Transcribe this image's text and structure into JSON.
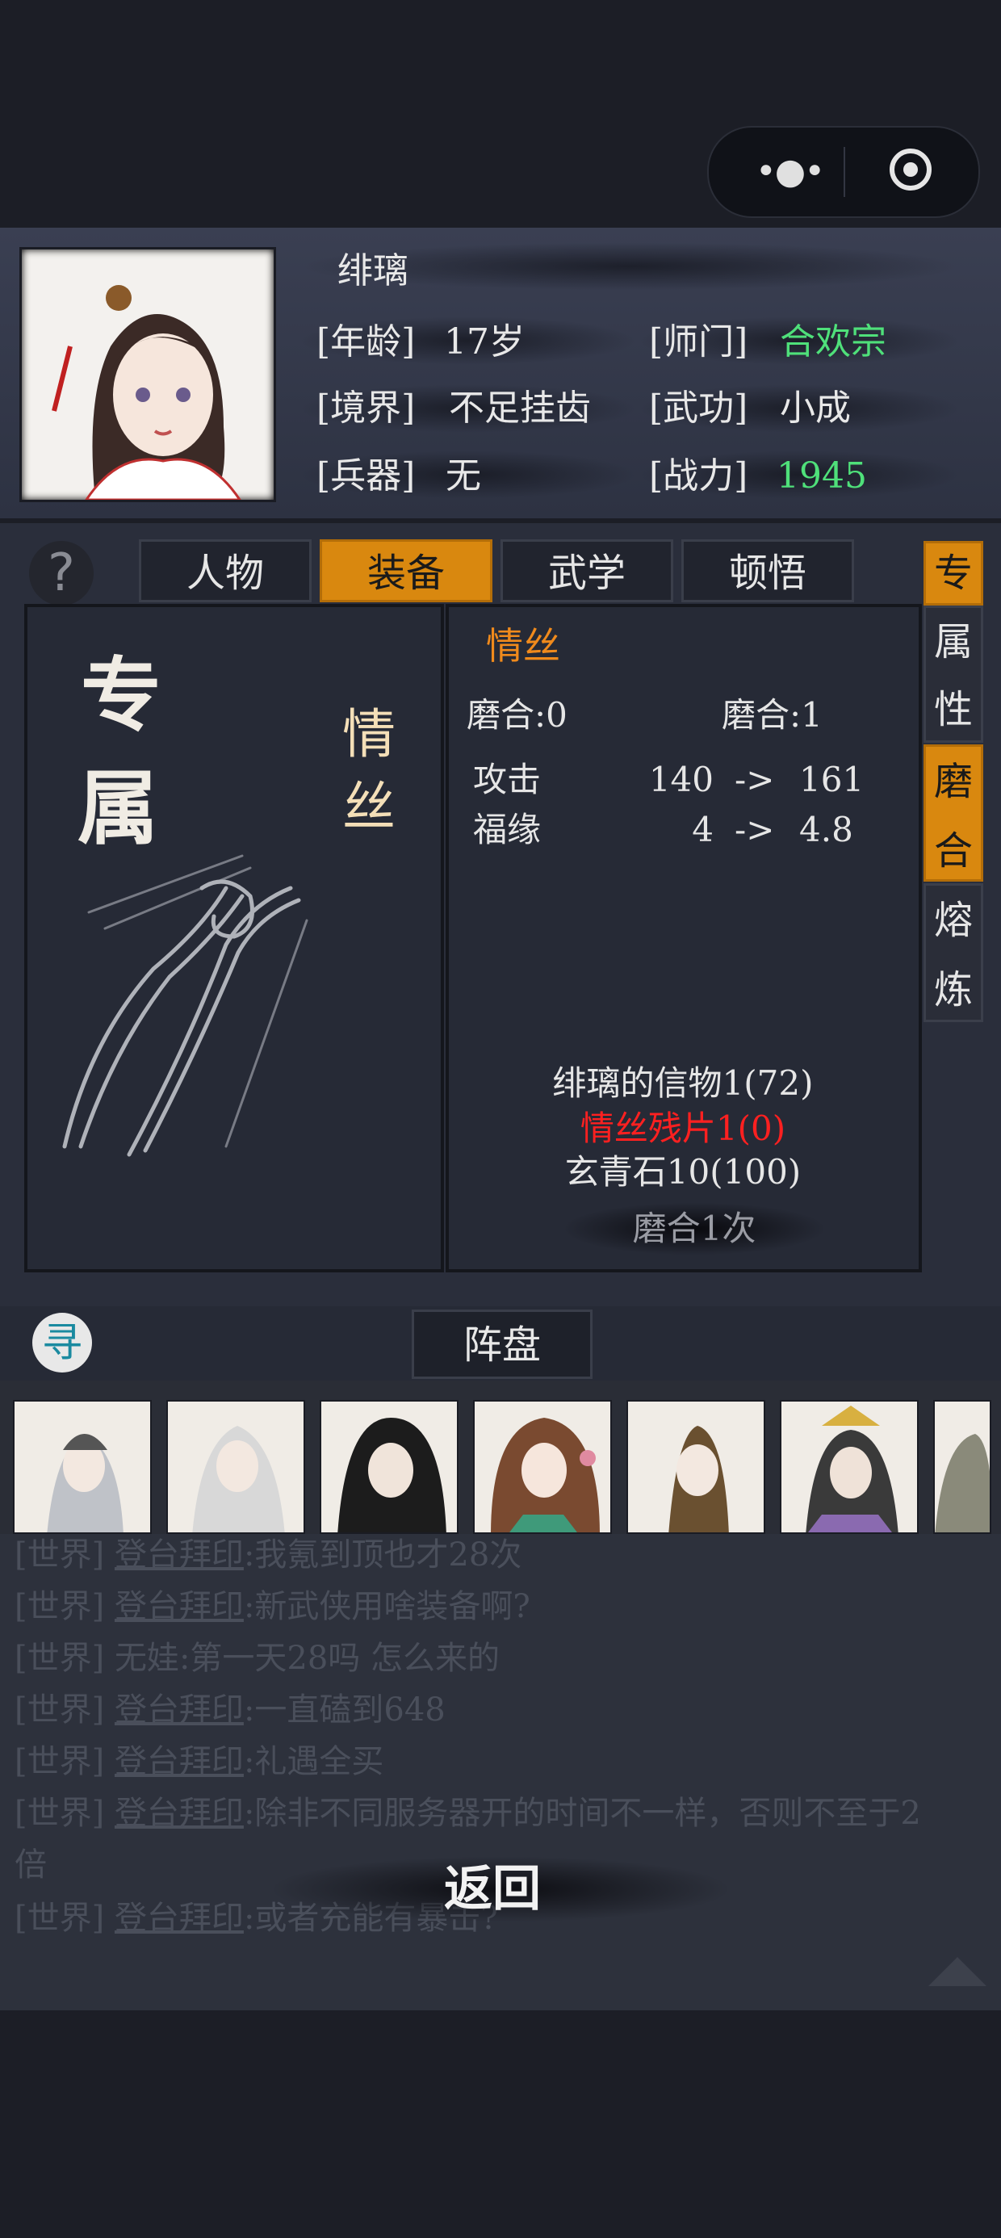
{
  "character": {
    "name": "绯璃",
    "age_label": "[年龄]",
    "age": "17岁",
    "sect_label": "[师门]",
    "sect": "合欢宗",
    "realm_label": "[境界]",
    "realm": "不足挂齿",
    "martial_label": "[武功]",
    "martial": "小成",
    "weapon_label": "[兵器]",
    "weapon": "无",
    "power_label": "[战力]",
    "power": "1945"
  },
  "tabs": [
    "人物",
    "装备",
    "武学",
    "顿悟"
  ],
  "side_tabs": [
    {
      "chars": [
        "专",
        "属"
      ],
      "active_first": true
    },
    {
      "chars": [
        "性"
      ]
    },
    {
      "chars": [
        "磨",
        "合"
      ],
      "active": true
    },
    {
      "chars": [
        "熔",
        "炼"
      ]
    }
  ],
  "help_icon": "?",
  "equipment": {
    "big_chars": [
      "专",
      "属"
    ],
    "name_vertical": [
      "情",
      "丝"
    ],
    "item_name": "情丝",
    "temper_current": "磨合:0",
    "temper_next": "磨合:1",
    "stats": [
      {
        "name": "攻击",
        "from": "140",
        "arrow": "->",
        "to": "161"
      },
      {
        "name": "福缘",
        "from": "4",
        "arrow": "->",
        "to": "4.8"
      }
    ],
    "materials": [
      "绯璃的信物1(72)",
      "情丝残片1(0)",
      "玄青石10(100)"
    ],
    "temper_button": "磨合1次"
  },
  "formation": {
    "seek_icon": "寻",
    "label": "阵盘"
  },
  "chat": [
    {
      "channel": "[世界]",
      "user": "登台拜印",
      "msg": ":我氪到顶也才28次"
    },
    {
      "channel": "[世界]",
      "user": "登台拜印",
      "msg": ":新武侠用啥装备啊?"
    },
    {
      "channel": "[世界]",
      "user": "无娃",
      "msg": ":第一天28吗 怎么来的"
    },
    {
      "channel": "[世界]",
      "user": "登台拜印",
      "msg": ":一直磕到648"
    },
    {
      "channel": "[世界]",
      "user": "登台拜印",
      "msg": ":礼遇全买"
    },
    {
      "channel": "[世界]",
      "user": "登台拜印",
      "msg": ":除非不同服务器开的时间不一样，否则不至于2"
    },
    {
      "channel": "",
      "user": "",
      "msg": "倍"
    },
    {
      "channel": "[世界]",
      "user": "登台拜印",
      "msg": ":或者充能有暴击?"
    }
  ],
  "back_label": "返回",
  "colors": {
    "accent": "#d9880f",
    "green": "#4fe07a",
    "red": "#ff2020",
    "orange": "#f08a1c"
  }
}
